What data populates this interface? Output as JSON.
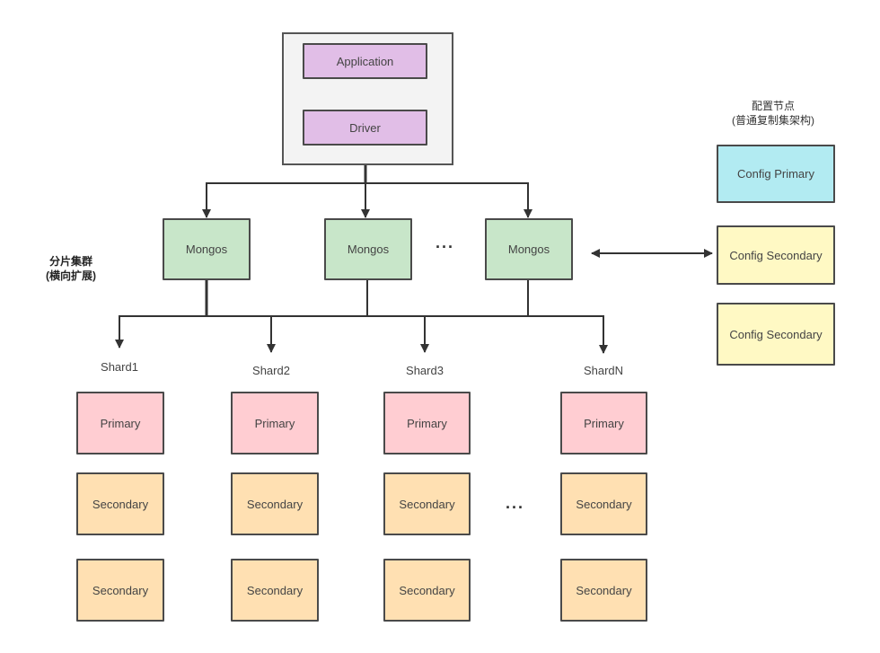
{
  "diagram": {
    "client": {
      "application": "Application",
      "driver": "Driver"
    },
    "routers": {
      "label_line1": "分片集群",
      "label_line2": "(横向扩展)",
      "nodes": [
        "Mongos",
        "Mongos",
        "Mongos"
      ],
      "ellipsis": "···"
    },
    "config": {
      "title_line1": "配置节点",
      "title_line2": "(普通复制集架构)",
      "primary": "Config Primary",
      "secondaries": [
        "Config Secondary",
        "Config Secondary"
      ]
    },
    "shards": [
      {
        "name": "Shard1",
        "primary": "Primary",
        "secondaries": [
          "Secondary",
          "Secondary"
        ]
      },
      {
        "name": "Shard2",
        "primary": "Primary",
        "secondaries": [
          "Secondary",
          "Secondary"
        ]
      },
      {
        "name": "Shard3",
        "primary": "Primary",
        "secondaries": [
          "Secondary",
          "Secondary"
        ]
      },
      {
        "name": "ShardN",
        "primary": "Primary",
        "secondaries": [
          "Secondary",
          "Secondary"
        ]
      }
    ],
    "shards_ellipsis": "···",
    "colors": {
      "client": "#e1bee7",
      "mongos": "#c8e6c9",
      "config_primary": "#b2ebf2",
      "config_secondary": "#fff9c4",
      "shard_primary": "#ffcdd2",
      "shard_secondary": "#ffe0b2",
      "container": "#f3f3f3",
      "line": "#333333"
    }
  }
}
